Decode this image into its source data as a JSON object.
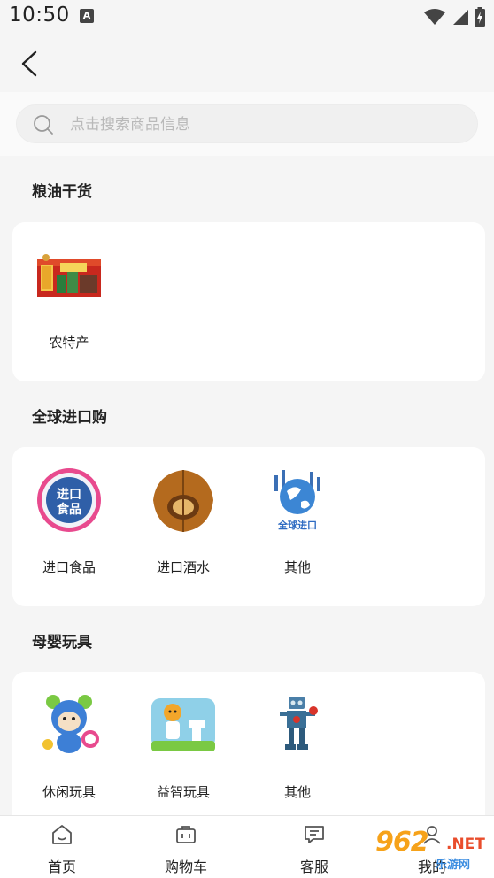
{
  "status_bar": {
    "time": "10:50",
    "notification_icon": "a-icon",
    "wifi_icon": "wifi-icon",
    "signal_icon": "signal-icon",
    "battery_icon": "battery-icon"
  },
  "header": {
    "back_icon": "chevron-left-icon"
  },
  "search": {
    "placeholder": "点击搜索商品信息",
    "icon": "search-icon"
  },
  "sections": [
    {
      "title": "粮油干货",
      "items": [
        {
          "label": "农特产"
        }
      ]
    },
    {
      "title": "全球进口购",
      "items": [
        {
          "label": "进口食品"
        },
        {
          "label": "进口酒水"
        },
        {
          "label": "其他"
        }
      ]
    },
    {
      "title": "母婴玩具",
      "items": [
        {
          "label": "休闲玩具"
        },
        {
          "label": "益智玩具"
        },
        {
          "label": "其他"
        }
      ]
    }
  ],
  "image_text": {
    "import_food_badge_line1": "进口",
    "import_food_badge_line2": "食品",
    "global_import_caption": "全球进口"
  },
  "tab_bar": [
    {
      "label": "首页",
      "icon": "home-icon"
    },
    {
      "label": "购物车",
      "icon": "cart-icon"
    },
    {
      "label": "客服",
      "icon": "chat-icon"
    },
    {
      "label": "我的",
      "icon": "user-icon"
    }
  ],
  "watermark": {
    "number": "962",
    "suffix": ".NET",
    "subtitle": "乐游网"
  },
  "colors": {
    "background": "#f5f5f5",
    "card": "#ffffff",
    "watermark_orange": "#f6a21a",
    "watermark_red": "#e94d2c",
    "watermark_blue": "#3c8de0"
  }
}
